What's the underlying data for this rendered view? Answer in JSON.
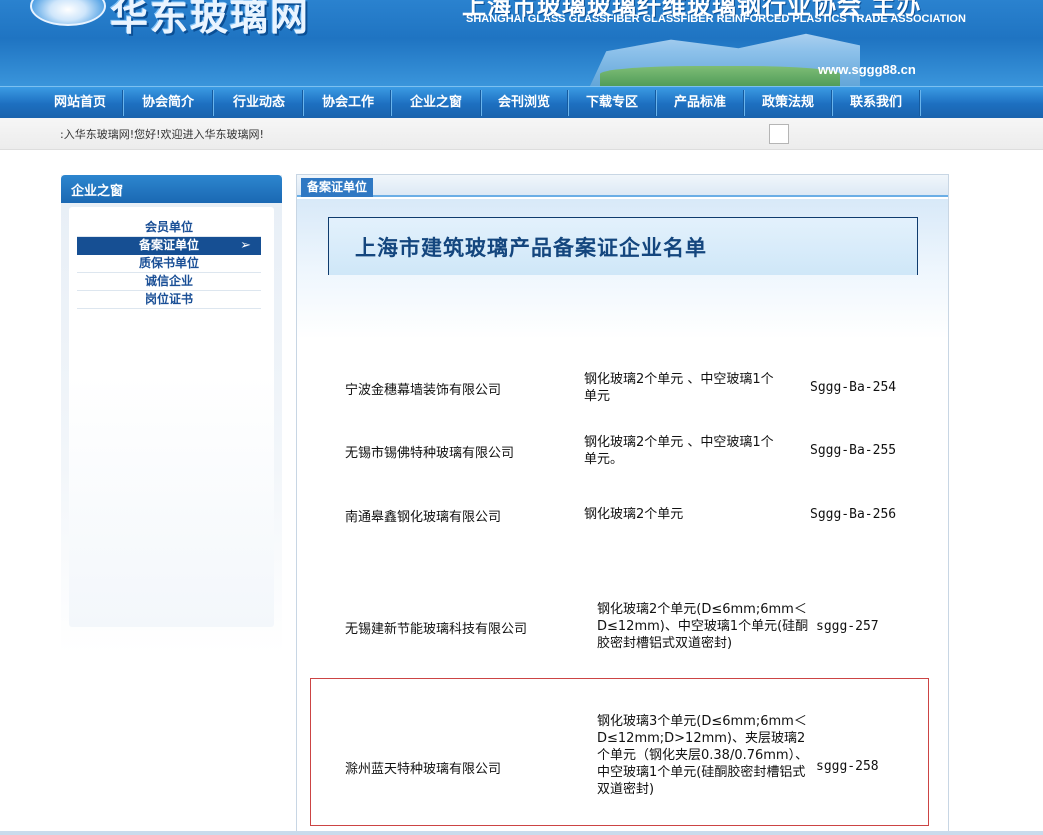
{
  "banner": {
    "logo_text": "华东玻璃网",
    "assoc_cn": "上海市玻璃玻璃纤维玻璃钢行业协会  主办",
    "assoc_en": "SHANGHAI GLASS GLASSFIBER GLASSFIBER REINFORCED PLASTICS TRADE ASSOCIATION",
    "url": "www.sggg88.cn"
  },
  "nav": {
    "items": [
      {
        "label": "网站首页"
      },
      {
        "label": "协会简介"
      },
      {
        "label": "行业动态"
      },
      {
        "label": "协会工作"
      },
      {
        "label": "企业之窗"
      },
      {
        "label": "会刊浏览"
      },
      {
        "label": "下载专区"
      },
      {
        "label": "产品标准"
      },
      {
        "label": "政策法规"
      },
      {
        "label": "联系我们"
      }
    ]
  },
  "marquee": {
    "text": ":入华东玻璃网!您好!欢迎进入华东玻璃网!"
  },
  "sidebar": {
    "title": "企业之窗",
    "items": [
      {
        "label": "会员单位",
        "active": false
      },
      {
        "label": "备案证单位",
        "active": true
      },
      {
        "label": "质保书单位",
        "active": false
      },
      {
        "label": "诚信企业",
        "active": false
      },
      {
        "label": "岗位证书",
        "active": false
      }
    ],
    "active_arrow": "➢"
  },
  "main": {
    "tab_label": "备案证单位",
    "heading": "上海市建筑玻璃产品备案证企业名单",
    "rows": [
      {
        "company": "宁波金穗幕墙装饰有限公司",
        "product": " 钢化玻璃2个单元 、中空玻璃1个单元",
        "code": "Sggg-Ba-254"
      },
      {
        "company": "无锡市锡佛特种玻璃有限公司",
        "product": " 钢化玻璃2个单元 、中空玻璃1个单元。",
        "code": "Sggg-Ba-255"
      },
      {
        "company": "南通皋鑫钢化玻璃有限公司",
        "product": " 钢化玻璃2个单元",
        "code": "Sggg-Ba-256"
      },
      {
        "company": "无锡建新节能玻璃科技有限公司",
        "product": "钢化玻璃2个单元(D≤6mm;6mm＜D≤12mm)、中空玻璃1个单元(硅酮胶密封槽铝式双道密封)",
        "code": "sggg-257"
      },
      {
        "company": "滁州蓝天特种玻璃有限公司",
        "product": "钢化玻璃3个单元(D≤6mm;6mm＜D≤12mm;D>12mm)、夹层玻璃2个单元（钢化夹层0.38/0.76mm）、中空玻璃1个单元(硅酮胶密封槽铝式双道密封)",
        "code": "sggg-258"
      }
    ]
  }
}
